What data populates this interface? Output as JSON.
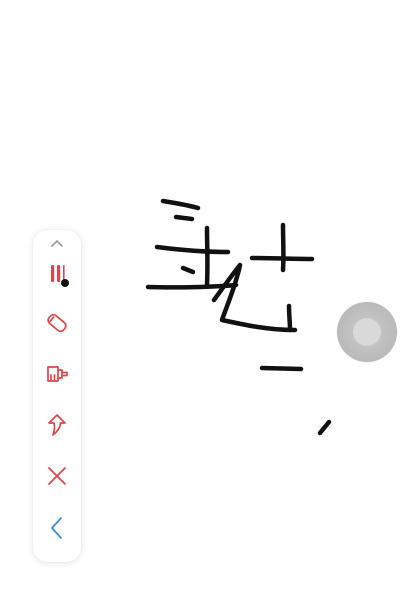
{
  "canvas": {
    "background": "#ffffff",
    "ink_color": "#111111"
  },
  "toolbar": {
    "accent_color": "#e0454a",
    "back_color": "#3b8fd6",
    "items": [
      {
        "name": "collapse-toolbar",
        "icon": "chevron-up-icon"
      },
      {
        "name": "pen-tool",
        "icon": "pen-width-icon"
      },
      {
        "name": "eraser-tool",
        "icon": "eraser-icon"
      },
      {
        "name": "clear-tool",
        "icon": "brush-icon"
      },
      {
        "name": "redo-tool",
        "icon": "curved-arrow-icon"
      },
      {
        "name": "close-tool",
        "icon": "close-icon"
      },
      {
        "name": "back-tool",
        "icon": "chevron-left-icon"
      }
    ]
  },
  "floating_button": {
    "icon": "assistive-touch-icon"
  }
}
